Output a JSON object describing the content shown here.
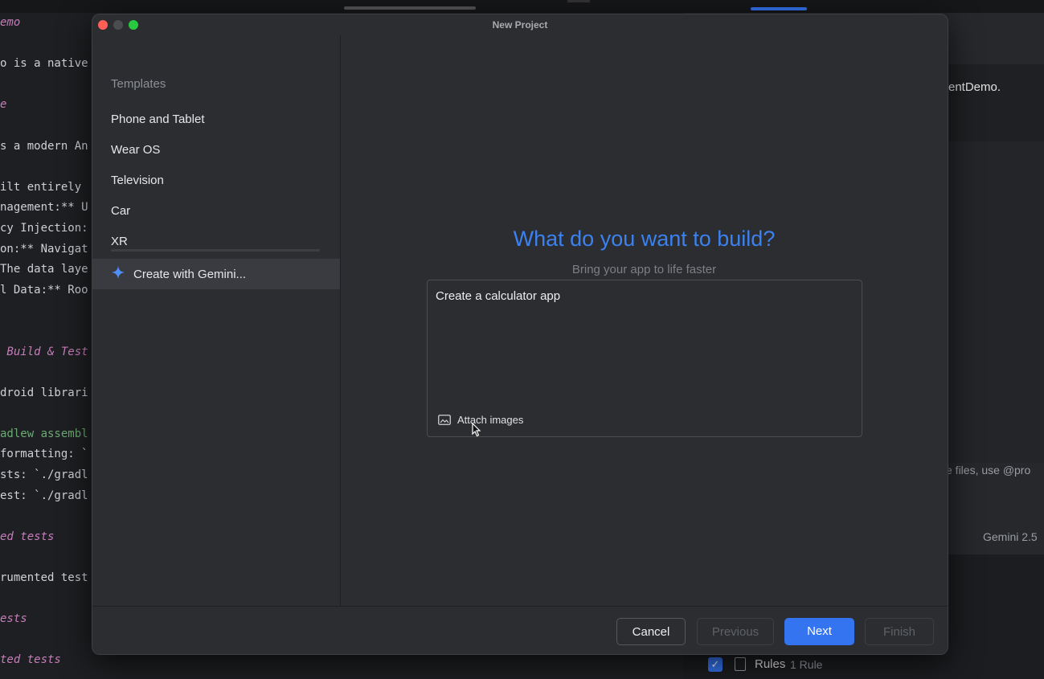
{
  "background": {
    "code_lines": [
      {
        "text": "emo",
        "style": "italic"
      },
      {
        "text": "o is a native",
        "style": "plain"
      },
      {
        "text": "e",
        "style": "italic"
      },
      {
        "text": "s a modern An",
        "style": "plain"
      },
      {
        "text": "ilt entirely",
        "style": "plain"
      },
      {
        "text": "nagement:** U",
        "style": "plain"
      },
      {
        "text": "cy Injection:",
        "style": "plain"
      },
      {
        "text": "on:** Navigat",
        "style": "plain"
      },
      {
        "text": "The data laye",
        "style": "plain"
      },
      {
        "text": "l Data:** Roo",
        "style": "plain"
      },
      {
        "text": " Build & Test",
        "style": "italic"
      },
      {
        "text": "droid librari",
        "style": "plain"
      },
      {
        "text": "adlew assembl",
        "style": "green"
      },
      {
        "text": "formatting: `",
        "style": "plain"
      },
      {
        "text": "sts: `./gradl",
        "style": "plain"
      },
      {
        "text": "est: `./gradl",
        "style": "plain"
      },
      {
        "text": "ed tests",
        "style": "italic"
      },
      {
        "text": "rumented test",
        "style": "plain"
      },
      {
        "text": "ests",
        "style": "italic"
      },
      {
        "text": "ted tests",
        "style": "italic"
      }
    ],
    "right_panel": {
      "text1": "entDemo.",
      "text2": "e files, use @pro",
      "model": "Gemini 2.5",
      "rules_label": "Rules",
      "rules_count": "1 Rule"
    }
  },
  "dialog": {
    "title": "New Project",
    "sidebar": {
      "heading": "Templates",
      "items": [
        "Phone and Tablet",
        "Wear OS",
        "Television",
        "Car",
        "XR"
      ],
      "selected_item": "Create with Gemini..."
    },
    "main": {
      "headline": "What do you want to build?",
      "subhead": "Bring your app to life faster",
      "prompt_value": "Create a calculator app",
      "attach_label": "Attach images"
    },
    "footer": {
      "cancel": "Cancel",
      "previous": "Previous",
      "next": "Next",
      "finish": "Finish"
    },
    "colors": {
      "accent": "#3574f0",
      "headline": "#3b82f0"
    }
  }
}
